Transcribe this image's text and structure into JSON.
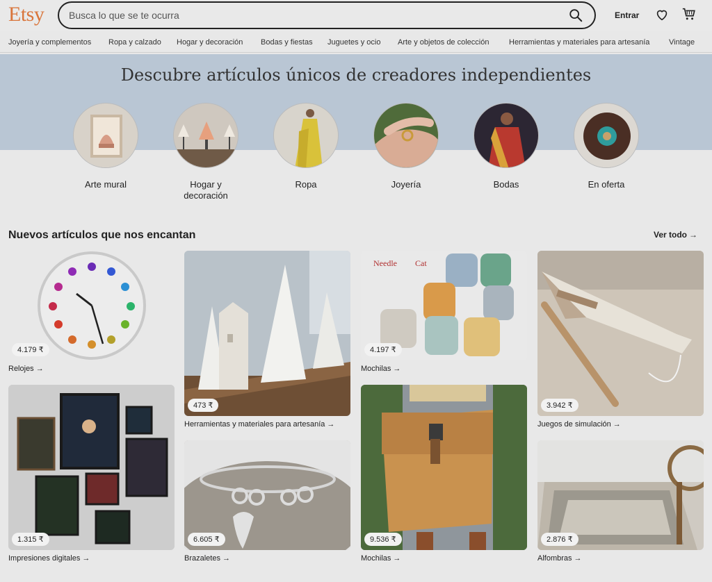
{
  "header": {
    "logo": "Etsy",
    "search_placeholder": "Busca lo que se te ocurra",
    "signin": "Entrar"
  },
  "nav": [
    "Joyería y complementos",
    "Ropa y calzado",
    "Hogar y decoración",
    "Bodas y fiestas",
    "Juguetes y ocio",
    "Arte y objetos de colección",
    "Herramientas y materiales para artesanía",
    "Vintage"
  ],
  "hero": {
    "title": "Descubre artículos únicos de creadores independientes",
    "categories": [
      "Arte mural",
      "Hogar y decoración",
      "Ropa",
      "Joyería",
      "Bodas",
      "En oferta"
    ]
  },
  "section": {
    "title": "Nuevos artículos que nos encantan",
    "see_all": "Ver todo"
  },
  "cards": [
    {
      "price": "4.179 ₹",
      "label": "Relojes"
    },
    {
      "price": "473 ₹",
      "label": "Herramientas y materiales para artesanía"
    },
    {
      "price": "4.197 ₹",
      "label": "Mochilas"
    },
    {
      "price": "3.942 ₹",
      "label": "Juegos de simulación"
    },
    {
      "price": "1.315 ₹",
      "label": "Impresiones digitales"
    },
    {
      "price": "6.605 ₹",
      "label": "Brazaletes"
    },
    {
      "price": "9.536 ₹",
      "label": "Mochilas"
    },
    {
      "price": "2.876 ₹",
      "label": "Alfombras"
    }
  ],
  "colors": {
    "brand": "#d9753b",
    "hero_band": "#b9c6d4",
    "page_bg": "#e8e8e8"
  }
}
